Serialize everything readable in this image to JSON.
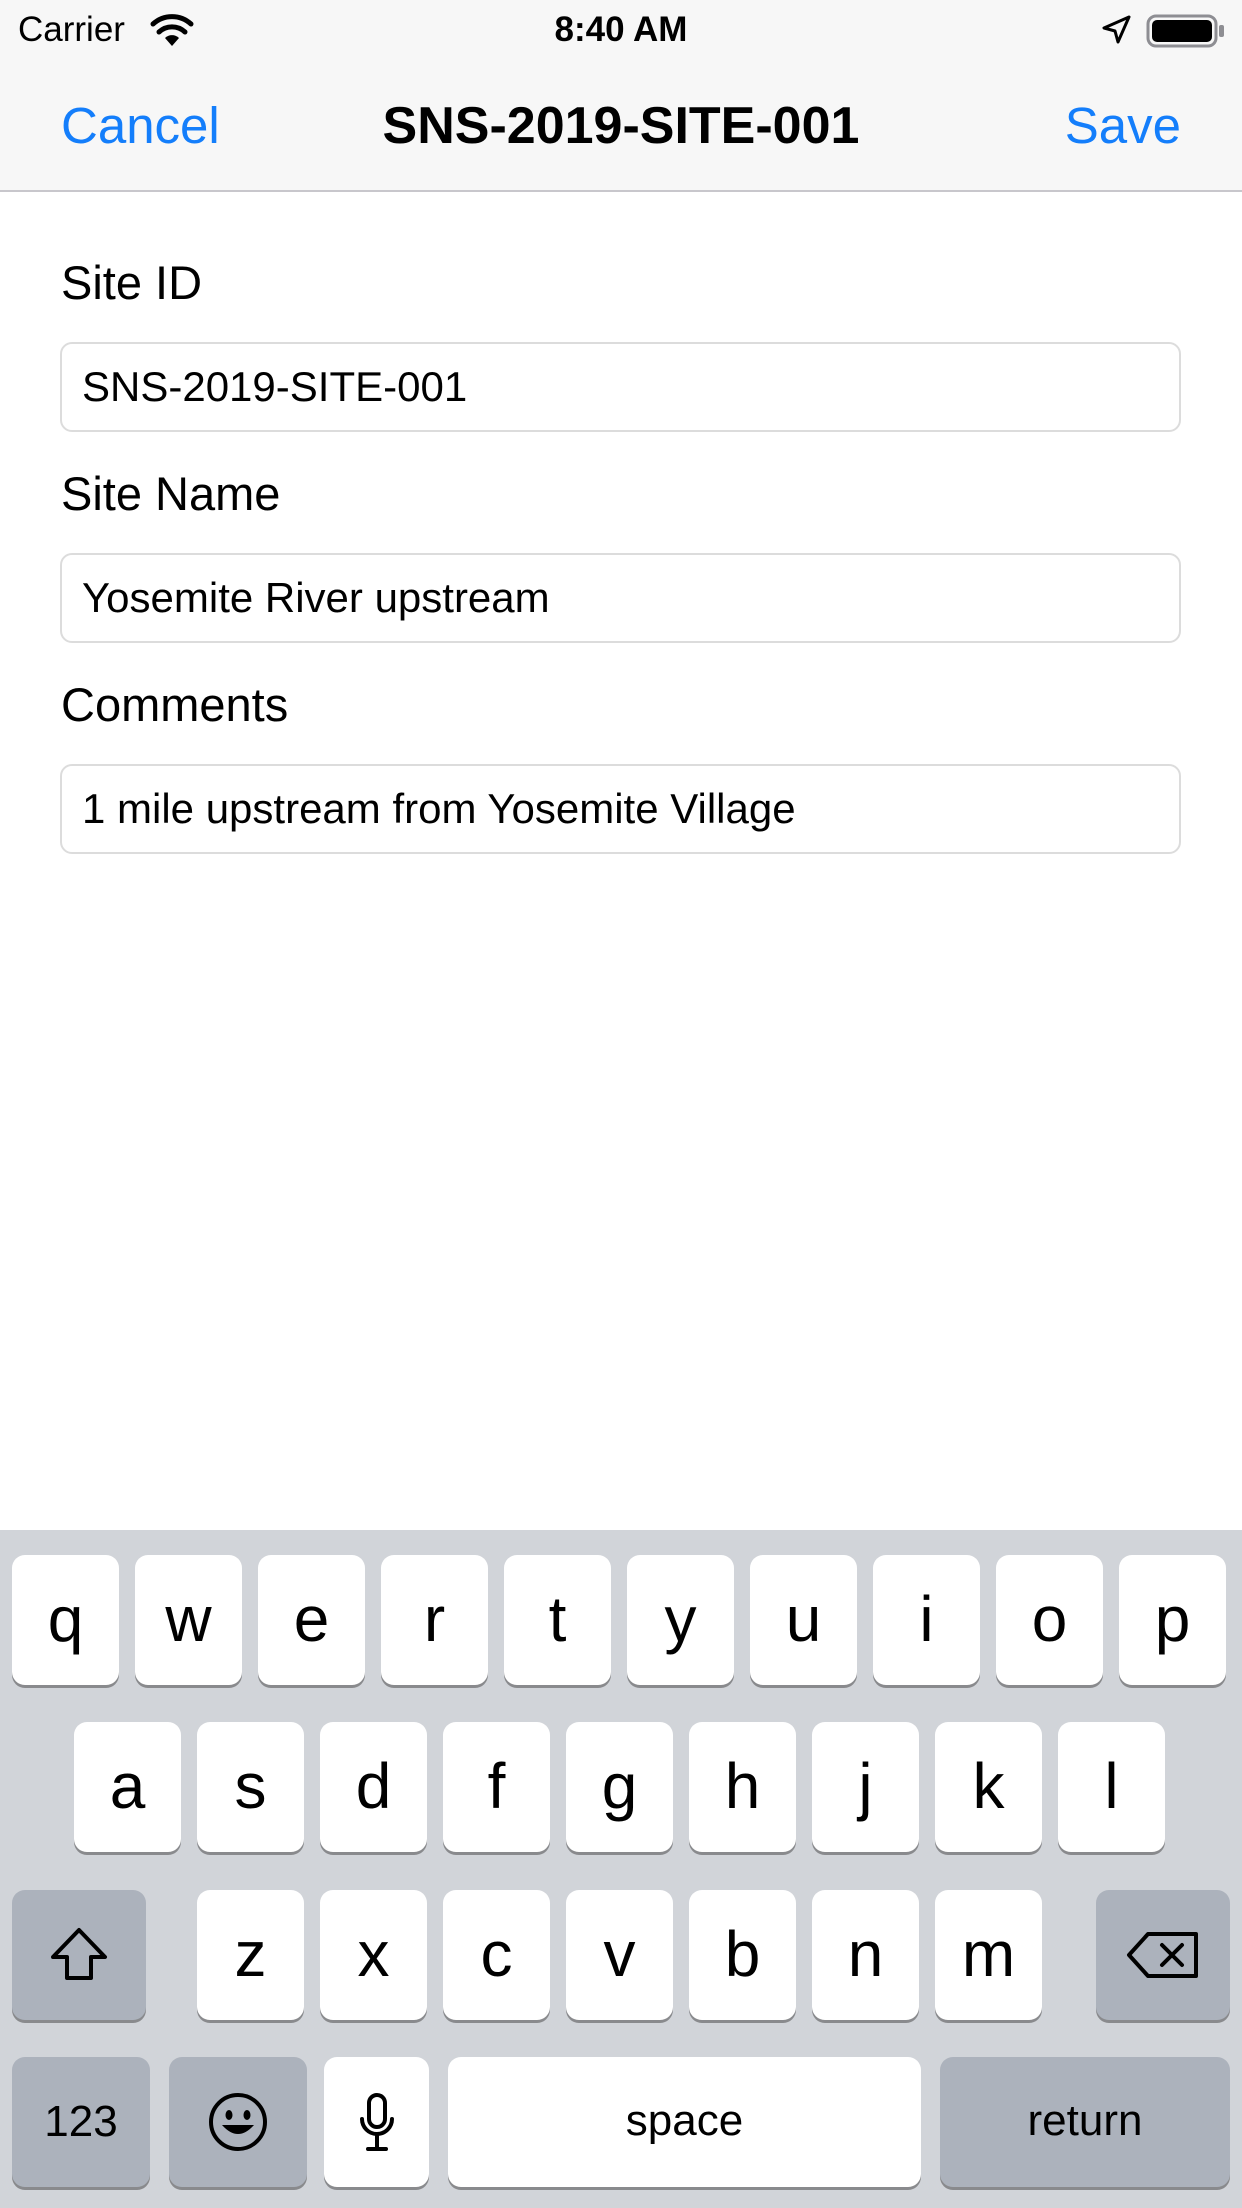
{
  "status_bar": {
    "carrier": "Carrier",
    "time": "8:40 AM",
    "icons": [
      "wifi-icon",
      "location-arrow-icon",
      "battery-icon"
    ]
  },
  "nav": {
    "cancel_label": "Cancel",
    "title": "SNS-2019-SITE-001",
    "save_label": "Save",
    "accent_color": "#147efb"
  },
  "form": {
    "site_id": {
      "label": "Site ID",
      "value": "SNS-2019-SITE-001"
    },
    "site_name": {
      "label": "Site Name",
      "value": "Yosemite River upstream"
    },
    "comments": {
      "label": "Comments",
      "value": "1 mile upstream from Yosemite Village"
    }
  },
  "keyboard": {
    "row1": [
      "q",
      "w",
      "e",
      "r",
      "t",
      "y",
      "u",
      "i",
      "o",
      "p"
    ],
    "row2": [
      "a",
      "s",
      "d",
      "f",
      "g",
      "h",
      "j",
      "k",
      "l"
    ],
    "row3": [
      "z",
      "x",
      "c",
      "v",
      "b",
      "n",
      "m"
    ],
    "numbers_label": "123",
    "space_label": "space",
    "return_label": "return",
    "icons": [
      "shift-icon",
      "delete-icon",
      "emoji-icon",
      "microphone-icon"
    ]
  }
}
